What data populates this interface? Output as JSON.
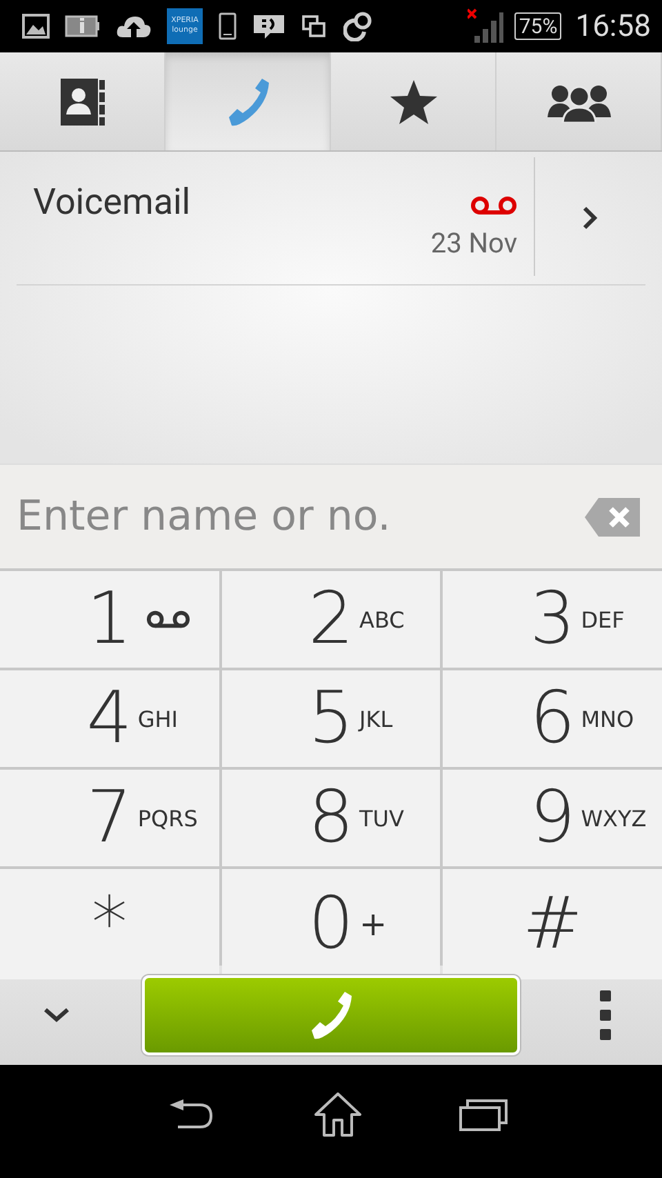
{
  "status_bar": {
    "notification_icons": [
      {
        "kind": "picture"
      },
      {
        "kind": "info"
      },
      {
        "kind": "upload"
      },
      {
        "kind": "lounge",
        "label": "XPERIA lounge"
      },
      {
        "kind": "phone"
      },
      {
        "kind": "message"
      },
      {
        "kind": "windows"
      },
      {
        "kind": "sync"
      }
    ],
    "signal_no_data": true,
    "battery": "75%",
    "time": "16:58"
  },
  "tabs": [
    {
      "kind": "contacts",
      "selected": false
    },
    {
      "kind": "phone",
      "selected": true
    },
    {
      "kind": "favorites",
      "selected": false
    },
    {
      "kind": "groups",
      "selected": false
    }
  ],
  "call_log": [
    {
      "name": "Voicemail",
      "kind": "voicemail",
      "date": "23 Nov"
    }
  ],
  "dial_field": {
    "placeholder": "Enter name or no."
  },
  "keys": [
    {
      "digit": "1",
      "kind": "voicemail"
    },
    {
      "digit": "2",
      "kind": "letters",
      "sub": "ABC"
    },
    {
      "digit": "3",
      "kind": "letters",
      "sub": "DEF"
    },
    {
      "digit": "4",
      "kind": "letters",
      "sub": "GHI"
    },
    {
      "digit": "5",
      "kind": "letters",
      "sub": "JKL"
    },
    {
      "digit": "6",
      "kind": "letters",
      "sub": "MNO"
    },
    {
      "digit": "7",
      "kind": "letters",
      "sub": "PQRS"
    },
    {
      "digit": "8",
      "kind": "letters",
      "sub": "TUV"
    },
    {
      "digit": "9",
      "kind": "letters",
      "sub": "WXYZ"
    },
    {
      "digit": "*",
      "kind": "plain"
    },
    {
      "digit": "0",
      "kind": "letters",
      "sub": "+"
    },
    {
      "digit": "#",
      "kind": "plain"
    }
  ]
}
